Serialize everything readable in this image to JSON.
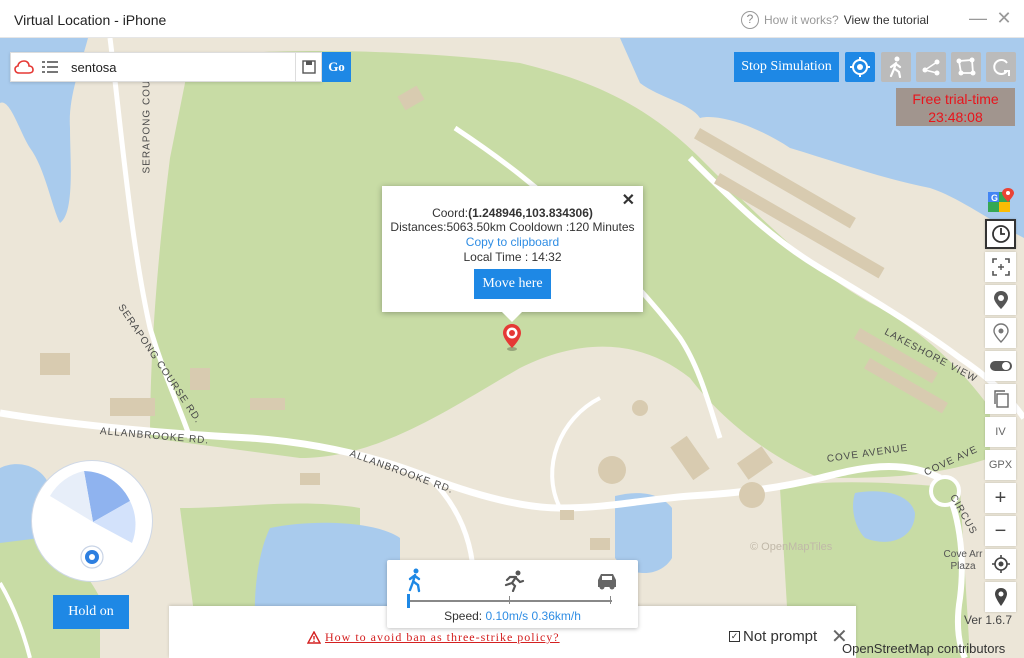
{
  "window": {
    "title": "Virtual Location - iPhone",
    "help_question": "How it works?",
    "help_link": "View the tutorial",
    "minimize_glyph": "—",
    "close_glyph": "✕"
  },
  "search": {
    "value": "sentosa",
    "go_label": "Go",
    "icons": [
      "cloud-icon",
      "list-icon",
      "save-icon"
    ]
  },
  "toolbar": {
    "stop_label": "Stop Simulation",
    "modes": [
      "teleport-mode-icon",
      "walk-mode-icon",
      "two-spot-mode-icon",
      "multi-spot-mode-icon",
      "joystick-mode-icon"
    ],
    "active_mode": "teleport-mode-icon",
    "accent": "#1e88e5"
  },
  "trial": {
    "label": "Free trial-time",
    "time": "23:48:08"
  },
  "right_tools": {
    "iv_label": "IV",
    "gpx_label": "GPX",
    "zoom_in": "+",
    "zoom_out": "−"
  },
  "popup": {
    "coord_prefix": "Coord:",
    "coord_value": "(1.248946,103.834306)",
    "distances": "Distances:5063.50km Cooldown :120 Minutes",
    "copy_label": "Copy to clipboard",
    "local_time": "Local Time : 14:32",
    "move_label": "Move here",
    "close_glyph": "✕"
  },
  "map": {
    "roads": [
      "SERAPONG COURSE",
      "SERAPONG COURSE RD.",
      "ALLANBROOKE RD.",
      "ALLANBROOKE RD.",
      "LAKESHORE VIEW",
      "COVE AVENUE",
      "COVE AVE",
      "CIRCUS"
    ],
    "place": "Cove Arr Plaza",
    "omt_credit": "© OpenMapTiles",
    "osm_credit": "OpenStreetMap contributors"
  },
  "hold_label": "Hold on",
  "speed": {
    "label": "Speed:",
    "ms": "0.10m/s",
    "kmh": "0.36km/h"
  },
  "notice": {
    "text": "How to avoid ban as three-strike policy?",
    "not_prompt": "Not prompt",
    "close_glyph": "✕"
  },
  "version": "Ver 1.6.7"
}
